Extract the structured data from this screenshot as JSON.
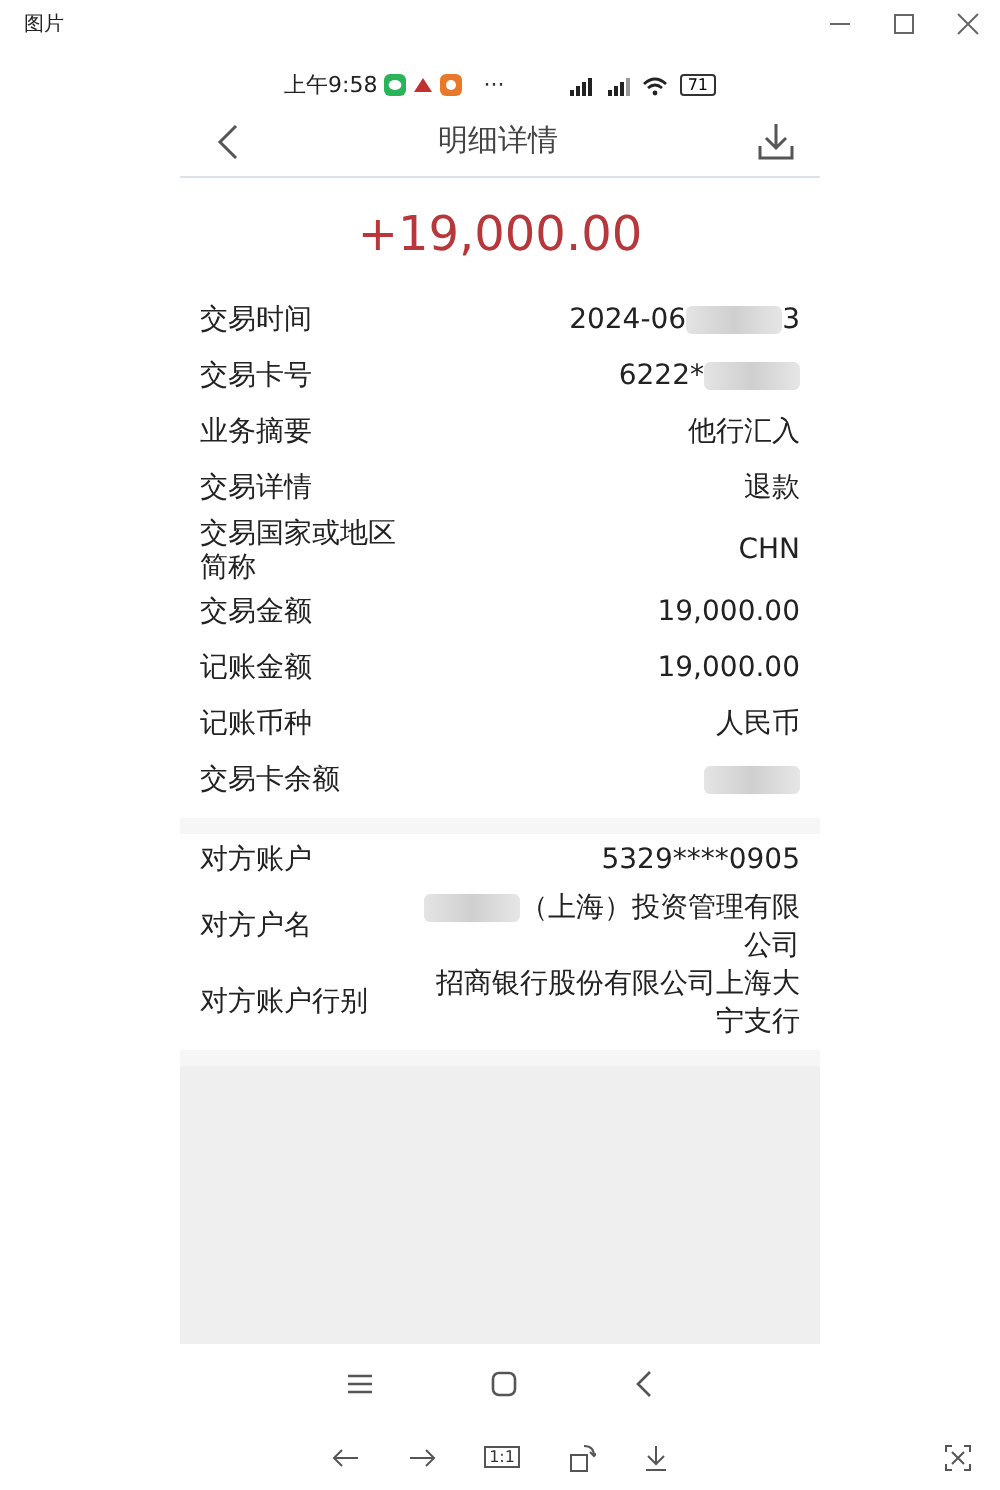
{
  "window": {
    "title": "图片"
  },
  "status_bar": {
    "time": "上午9:58",
    "more": "···",
    "battery": "71"
  },
  "header": {
    "title": "明细详情"
  },
  "amount": "+19,000.00",
  "sections": [
    {
      "rows": [
        {
          "label": "交易时间",
          "value": [
            {
              "kind": "text",
              "text": "2024-06"
            },
            {
              "kind": "blur"
            },
            {
              "kind": "text",
              "text": "3"
            }
          ]
        },
        {
          "label": "交易卡号",
          "value": [
            {
              "kind": "text",
              "text": "6222*"
            },
            {
              "kind": "blur"
            }
          ]
        },
        {
          "label": "业务摘要",
          "value": [
            {
              "kind": "text",
              "text": "他行汇入"
            }
          ]
        },
        {
          "label": "交易详情",
          "value": [
            {
              "kind": "text",
              "text": "退款"
            }
          ]
        },
        {
          "label": "交易国家或地区简称",
          "value": [
            {
              "kind": "text",
              "text": "CHN"
            }
          ]
        },
        {
          "label": "交易金额",
          "value": [
            {
              "kind": "text",
              "text": "19,000.00"
            }
          ]
        },
        {
          "label": "记账金额",
          "value": [
            {
              "kind": "text",
              "text": "19,000.00"
            }
          ]
        },
        {
          "label": "记账币种",
          "value": [
            {
              "kind": "text",
              "text": "人民币"
            }
          ]
        },
        {
          "label": "交易卡余额",
          "value": [
            {
              "kind": "blur"
            }
          ]
        }
      ]
    },
    {
      "rows": [
        {
          "label": "对方账户",
          "value": [
            {
              "kind": "text",
              "text": "5329****0905"
            }
          ]
        },
        {
          "label": "对方户名",
          "value": [
            {
              "kind": "blur"
            },
            {
              "kind": "text",
              "text": "（上海）投资管理有限公司"
            }
          ]
        },
        {
          "label": "对方账户行别",
          "value": [
            {
              "kind": "text",
              "text": "招商银行股份有限公司上海大宁支行"
            }
          ]
        }
      ]
    }
  ],
  "viewer_toolbar": {
    "actual_size": "1:1"
  }
}
